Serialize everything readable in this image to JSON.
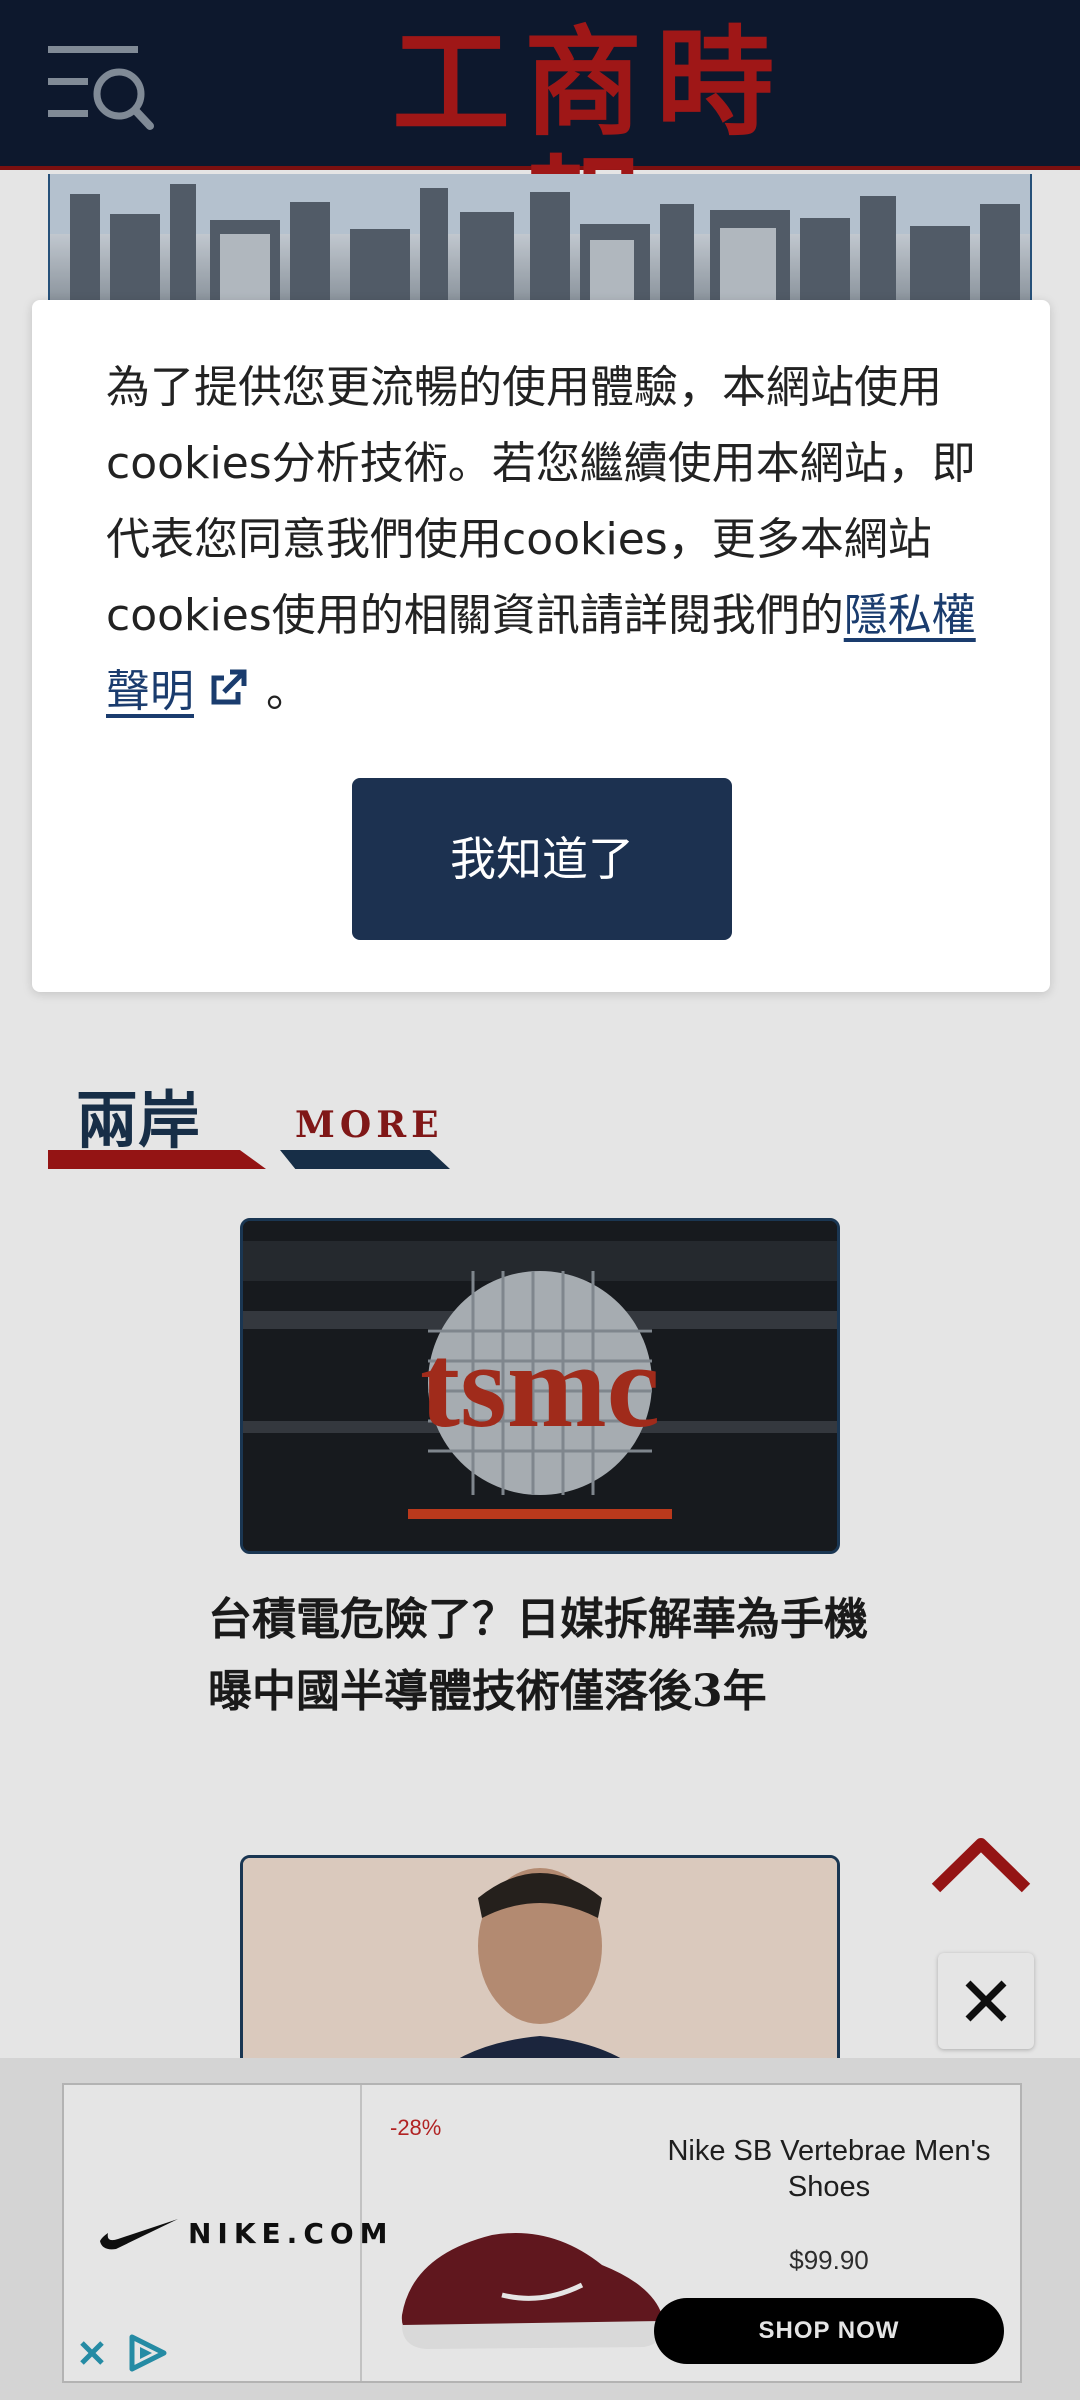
{
  "header": {
    "logo_text": "工商時報",
    "menu_icon": "menu-search-icon"
  },
  "cookie_dialog": {
    "message": "為了提供您更流暢的使用體驗，本網站使用cookies分析技術。若您繼續使用本網站，即代表您同意我們使用cookies，更多本網站cookies使用的相關資訊請詳閱我們的",
    "policy_link": "隱私權聲明",
    "suffix": " 。",
    "button_label": "我知道了"
  },
  "section": {
    "title": "兩岸",
    "more": "MORE"
  },
  "articles": [
    {
      "image_text": "tsmc",
      "title": "台積電危險了？日媒拆解華為手機 曝中國半導體技術僅落後3年"
    },
    {
      "image_text": "",
      "title": ""
    }
  ],
  "ad": {
    "brand": "NIKE.COM",
    "discount": "-28%",
    "product_name": "Nike SB Vertebrae Men's Shoes",
    "price": "$99.90",
    "cta": "SHOP NOW"
  },
  "colors": {
    "header_bg": "#0f1b33",
    "brand_red": "#b21a1a",
    "section_blue": "#1a3450",
    "dialog_button": "#1c3150"
  }
}
